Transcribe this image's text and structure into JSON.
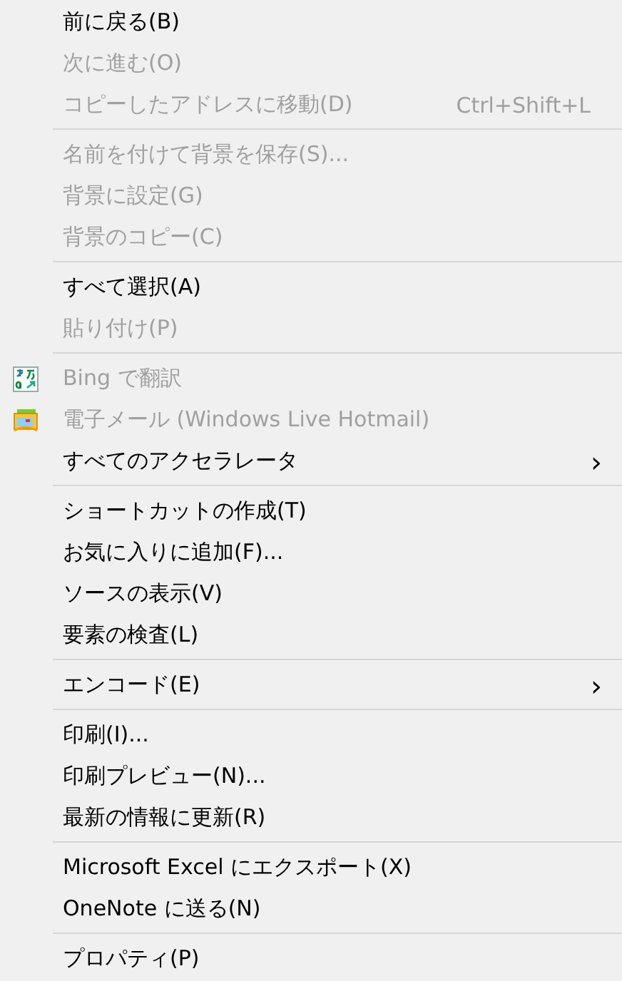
{
  "menu": {
    "groups": [
      {
        "items": [
          {
            "label": "前に戻る(B)",
            "disabled": false,
            "kind": "plain"
          },
          {
            "label": "次に進む(O)",
            "disabled": true,
            "kind": "plain"
          },
          {
            "label": "コピーしたアドレスに移動(D)",
            "disabled": true,
            "kind": "plain",
            "shortcut": "Ctrl+Shift+L"
          }
        ]
      },
      {
        "items": [
          {
            "label": "名前を付けて背景を保存(S)...",
            "disabled": true,
            "kind": "plain"
          },
          {
            "label": "背景に設定(G)",
            "disabled": true,
            "kind": "plain"
          },
          {
            "label": "背景のコピー(C)",
            "disabled": true,
            "kind": "plain"
          }
        ]
      },
      {
        "items": [
          {
            "label": "すべて選択(A)",
            "disabled": false,
            "kind": "plain"
          },
          {
            "label": "貼り付け(P)",
            "disabled": true,
            "kind": "plain"
          }
        ]
      },
      {
        "items": [
          {
            "label": "Bing で翻訳",
            "disabled": true,
            "kind": "translator"
          },
          {
            "label": "電子メール (Windows Live Hotmail)",
            "disabled": true,
            "kind": "mailer"
          },
          {
            "label": "すべてのアクセラレータ",
            "disabled": false,
            "kind": "submenu",
            "arrow": "›"
          }
        ]
      },
      {
        "items": [
          {
            "label": "ショートカットの作成(T)",
            "disabled": false,
            "kind": "plain"
          },
          {
            "label": "お気に入りに追加(F)...",
            "disabled": false,
            "kind": "plain"
          },
          {
            "label": "ソースの表示(V)",
            "disabled": false,
            "kind": "plain"
          },
          {
            "label": "要素の検査(L)",
            "disabled": false,
            "kind": "plain"
          }
        ]
      },
      {
        "items": [
          {
            "label": "エンコード(E)",
            "disabled": false,
            "kind": "submenu",
            "arrow": "›"
          }
        ]
      },
      {
        "items": [
          {
            "label": "印刷(I)...",
            "disabled": false,
            "kind": "plain"
          },
          {
            "label": "印刷プレビュー(N)...",
            "disabled": false,
            "kind": "plain"
          },
          {
            "label": "最新の情報に更新(R)",
            "disabled": false,
            "kind": "plain"
          }
        ]
      },
      {
        "items": [
          {
            "label": "Microsoft Excel にエクスポート(X)",
            "disabled": false,
            "kind": "plain"
          },
          {
            "label": "OneNote に送る(N)",
            "disabled": false,
            "kind": "plain"
          }
        ]
      },
      {
        "items": [
          {
            "label": "プロパティ(P)",
            "disabled": false,
            "kind": "plain"
          }
        ]
      }
    ]
  }
}
